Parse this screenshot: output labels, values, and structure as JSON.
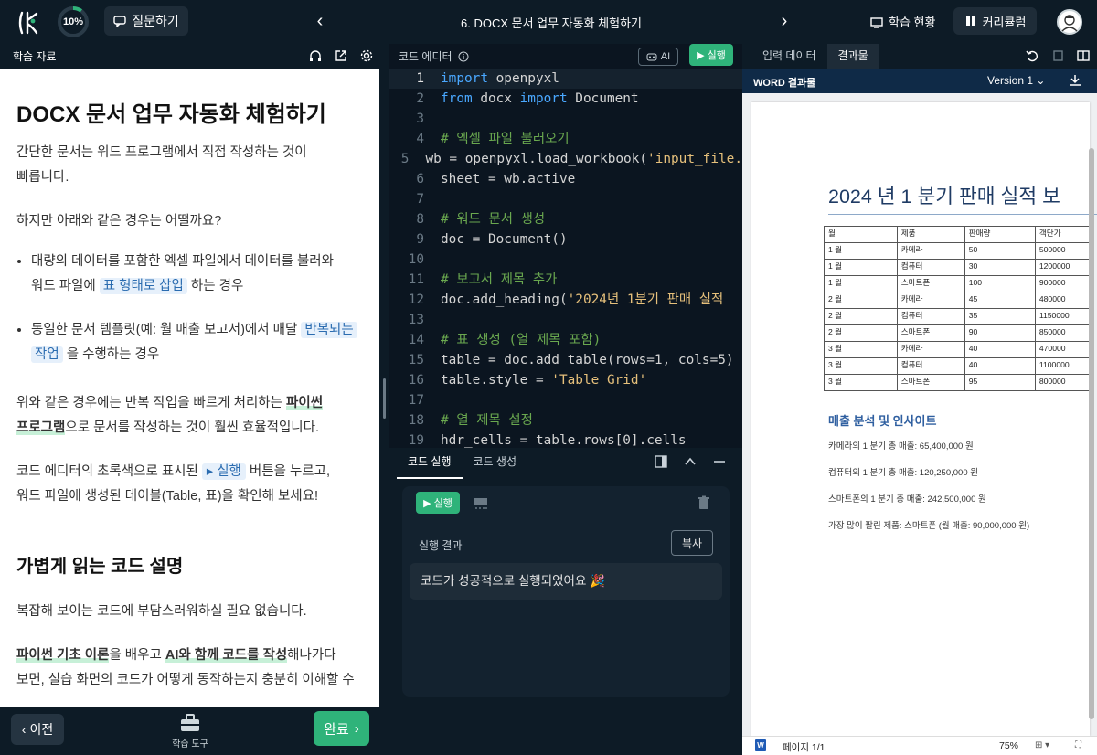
{
  "topbar": {
    "progress": "10%",
    "progress_value": 0.1,
    "ask_label": "질문하기",
    "lesson_title": "6. DOCX 문서 업무 자동화 체험하기",
    "status_label": "학습 현황",
    "curriculum_label": "커리큘럼"
  },
  "left": {
    "header": "학습 자료",
    "title": "DOCX 문서 업무 자동화 체험하기",
    "p1": "간단한 문서는 워드 프로그램에서 직접 작성하는 것이",
    "p1b": "빠릅니다.",
    "p2": "하지만 아래와 같은 경우는 어떨까요?",
    "b1a": "대량의 데이터를 포함한 엑셀 파일에서 데이터를 불러와",
    "b1b": "워드 파일에",
    "b1hl": "표 형태로 삽입",
    "b1c": "하는 경우",
    "b2a": "동일한 문서 템플릿(예: 월 매출 보고서)에서 매달",
    "b2hl1": "반복되는",
    "b2hl2": "작업",
    "b2c": "을 수행하는 경우",
    "p3a": "위와 같은 경우에는 반복 작업을 빠르게 처리하는",
    "p3u1": "파이썬",
    "p3u2": "프로그램",
    "p3b": "으로 문서를 작성하는 것이 훨씬 효율적입니다.",
    "p4a": "코드 에디터의 초록색으로 표시된",
    "p4run": "▸ 실행",
    "p4b": "버튼을 누르고,",
    "p4c": "워드 파일에 생성된 테이블(Table, 표)을 확인해 보세요!",
    "h2": "가볍게 읽는 코드 설명",
    "p5": "복잡해 보이는 코드에 부담스러워하실 필요 없습니다.",
    "p6u1": "파이썬 기초 이론",
    "p6a": "을 배우고",
    "p6u2": "AI와 함께 코드를 작성",
    "p6b": "해나가다",
    "p6c": "보면, 실습 화면의 코드가 어떻게 동작하는지 충분히 이해할 수",
    "prev_label": "이전",
    "tool_label": "학습 도구",
    "done_label": "완료"
  },
  "editor": {
    "header": "코드 에디터",
    "ai_label": "AI",
    "run_label": "실행",
    "lines": [
      {
        "n": "1",
        "t": "import openpyxl"
      },
      {
        "n": "2",
        "t": "from docx import Document"
      },
      {
        "n": "3",
        "t": ""
      },
      {
        "n": "4",
        "t": "# 엑셀 파일 불러오기"
      },
      {
        "n": "5",
        "t": "wb = openpyxl.load_workbook('input_file."
      },
      {
        "n": "6",
        "t": "sheet = wb.active"
      },
      {
        "n": "7",
        "t": ""
      },
      {
        "n": "8",
        "t": "# 워드 문서 생성"
      },
      {
        "n": "9",
        "t": "doc = Document()"
      },
      {
        "n": "10",
        "t": ""
      },
      {
        "n": "11",
        "t": "# 보고서 제목 추가"
      },
      {
        "n": "12",
        "t": "doc.add_heading('2024년 1분기 판매 실적"
      },
      {
        "n": "13",
        "t": ""
      },
      {
        "n": "14",
        "t": "# 표 생성 (열 제목 포함)"
      },
      {
        "n": "15",
        "t": "table = doc.add_table(rows=1, cols=5)"
      },
      {
        "n": "16",
        "t": "table.style = 'Table Grid'"
      },
      {
        "n": "17",
        "t": ""
      },
      {
        "n": "18",
        "t": "# 열 제목 설정"
      },
      {
        "n": "19",
        "t": "hdr_cells = table.rows[0].cells"
      }
    ]
  },
  "console": {
    "tab_run": "코드 실행",
    "tab_gen": "코드 생성",
    "run_label": "실행",
    "result_label": "실행 결과",
    "copy_label": "복사",
    "output": "코드가 성공적으로 실행되었어요 🎉"
  },
  "right": {
    "tab_input": "입력 데이터",
    "tab_output": "결과물",
    "word_label": "WORD 결과물",
    "version_label": "Version 1",
    "doc_title": "2024 년 1 분기 판매 실적 보",
    "table_header": [
      "월",
      "제품",
      "판매량",
      "객단가"
    ],
    "table_rows": [
      [
        "1 월",
        "카메라",
        "50",
        "500000"
      ],
      [
        "1 월",
        "컴퓨터",
        "30",
        "1200000"
      ],
      [
        "1 월",
        "스마트폰",
        "100",
        "900000"
      ],
      [
        "2 월",
        "카메라",
        "45",
        "480000"
      ],
      [
        "2 월",
        "컴퓨터",
        "35",
        "1150000"
      ],
      [
        "2 월",
        "스마트폰",
        "90",
        "850000"
      ],
      [
        "3 월",
        "카메라",
        "40",
        "470000"
      ],
      [
        "3 월",
        "컴퓨터",
        "40",
        "1100000"
      ],
      [
        "3 월",
        "스마트폰",
        "95",
        "800000"
      ]
    ],
    "section_title": "매출 분석 및 인사이트",
    "insight1": "카메라의 1 분기 총 매출: 65,400,000 원",
    "insight2": "컴퓨터의 1 분기 총 매출: 120,250,000 원",
    "insight3": "스마트폰의 1 분기 총 매출: 242,500,000 원",
    "insight4": "가장 많이 팔린 제품: 스마트폰 (월 매출: 90,000,000 원)",
    "page_label": "페이지 1/1",
    "zoom_label": "75%"
  },
  "colors": {
    "accent": "#2fb37a",
    "dark_bg": "#0d1b26",
    "word_bar": "#0f2a47",
    "link": "#2b6cb0"
  }
}
